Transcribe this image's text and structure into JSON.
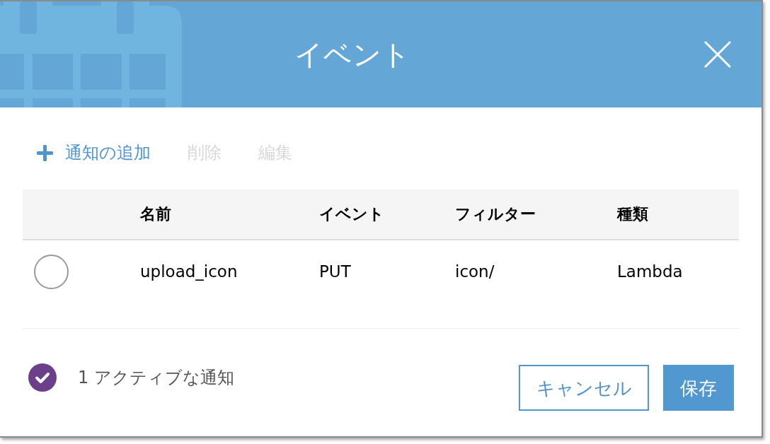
{
  "dialog": {
    "title": "イベント"
  },
  "toolbar": [
    {
      "label": "通知の追加",
      "kind": "add",
      "disabled": false
    },
    {
      "label": "削除",
      "kind": "plain",
      "disabled": true
    },
    {
      "label": "編集",
      "kind": "plain",
      "disabled": true
    }
  ],
  "table": {
    "columns": [
      "名前",
      "イベント",
      "フィルター",
      "種類"
    ],
    "rows": [
      {
        "selected": false,
        "cells": [
          "upload_icon",
          "PUT",
          "icon/",
          "Lambda"
        ]
      }
    ]
  },
  "footer": {
    "status": "1 アクティブな通知",
    "buttons": [
      {
        "label": "キャンセル",
        "kind": "secondary"
      },
      {
        "label": "保存",
        "kind": "primary"
      }
    ]
  }
}
